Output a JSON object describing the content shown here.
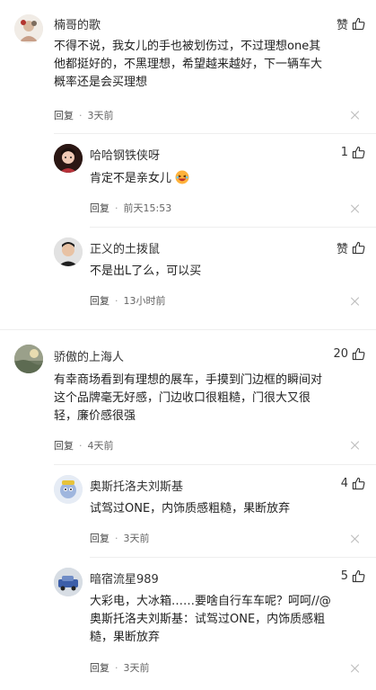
{
  "comments": [
    {
      "user": "楠哥的歌",
      "like_label": "赞",
      "text_lines": [
        "不得不说，我女儿的手也被划伤过，不过理想one其",
        "他都挺好的，不黑理想，希望越来越好，下一辆车大",
        "概率还是会买理想"
      ],
      "reply_label": "回复",
      "dot": "·",
      "time": "3天前",
      "replies": [
        {
          "user": "哈哈钢铁侠呀",
          "like_label": "1",
          "text": "肯定不是亲女儿",
          "emoji": "laughing-emoji",
          "reply_label": "回复",
          "dot": "·",
          "time": "前天15:53"
        },
        {
          "user": "正义的土拨鼠",
          "like_label": "赞",
          "text": "不是出L了么，可以买",
          "reply_label": "回复",
          "dot": "·",
          "time": "13小时前"
        }
      ]
    },
    {
      "user": "骄傲的上海人",
      "like_label": "20",
      "text_lines": [
        "有幸商场看到有理想的展车，手摸到门边框的瞬间对",
        "这个品牌毫无好感，门边收口很粗糙，门很大又很",
        "轻，廉价感很强"
      ],
      "reply_label": "回复",
      "dot": "·",
      "time": "4天前",
      "replies": [
        {
          "user": "奥斯托洛夫刘斯基",
          "like_label": "4",
          "text": "试驾过ONE，内饰质感粗糙，果断放弃",
          "reply_label": "回复",
          "dot": "·",
          "time": "3天前"
        },
        {
          "user": "暗宿流星989",
          "like_label": "5",
          "text_lines": [
            "大彩电，大冰箱……要啥自行车车呢？呵呵//@",
            "奥斯托洛夫刘斯基：试驾过ONE，内饰质感粗",
            "糙，果断放弃"
          ],
          "reply_label": "回复",
          "dot": "·",
          "time": "3天前"
        }
      ]
    }
  ],
  "colors": {
    "text": "#222222",
    "meta": "#666666",
    "divider": "#eeeeee"
  },
  "icons": [
    "thumbs-up-icon",
    "close-icon"
  ]
}
